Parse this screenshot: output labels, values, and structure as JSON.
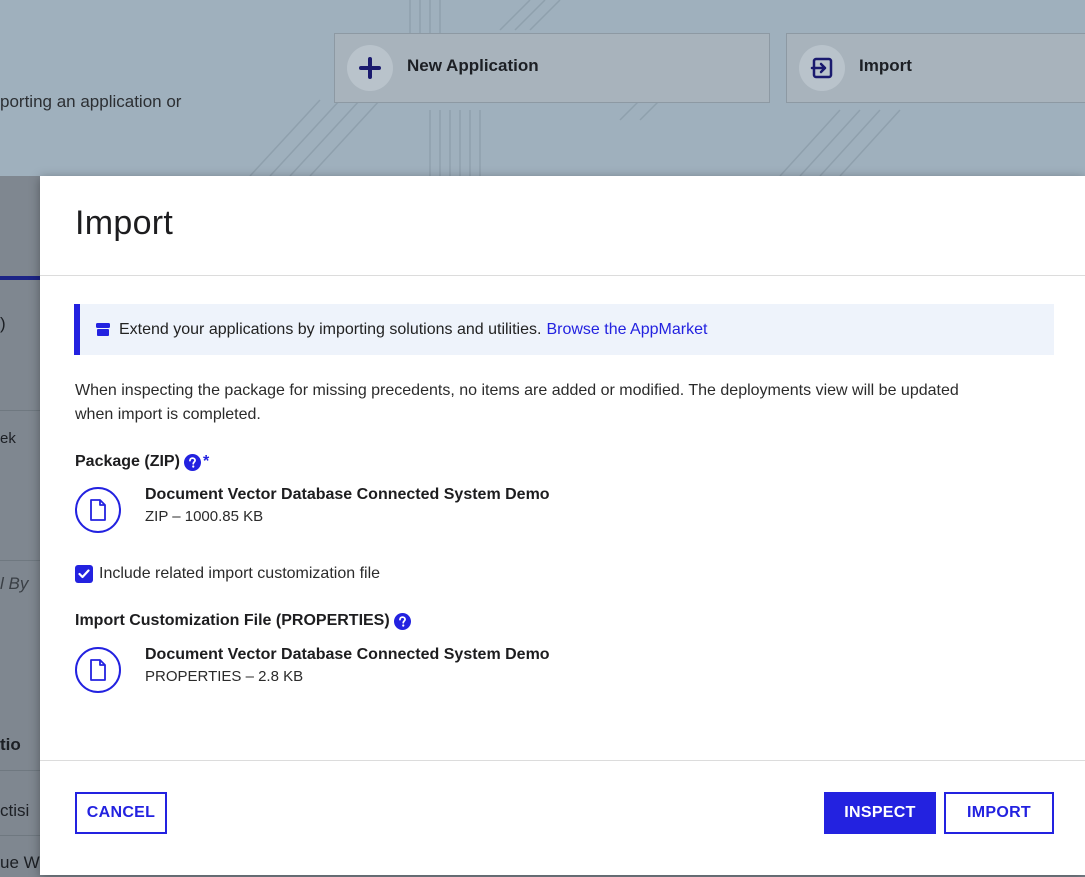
{
  "background": {
    "banner_text": "porting an application or",
    "tiles": {
      "new_application": {
        "label": "New Application",
        "icon": "plus-icon"
      },
      "import": {
        "label": "Import",
        "icon": "import-arrow-icon"
      }
    },
    "side_fragments": {
      "frag1": ")",
      "frag2": "ek",
      "frag3": "l By",
      "frag4": "tio",
      "frag5": "ctisi",
      "frag6": "ue W"
    }
  },
  "modal": {
    "title": "Import",
    "info": {
      "text": "Extend your applications by importing solutions and utilities.",
      "link": "Browse the AppMarket",
      "icon": "store-icon"
    },
    "description": "When inspecting the package for missing precedents, no items are added or modified. The deployments view will be updated when import is completed.",
    "package": {
      "label": "Package (ZIP)",
      "required_mark": "*",
      "file_name": "Document Vector Database Connected System Demo",
      "file_meta": "ZIP – 1000.85 KB"
    },
    "include_customization": {
      "label": "Include related import customization file",
      "checked": true
    },
    "customization": {
      "label": "Import Customization File (PROPERTIES)",
      "file_name": "Document Vector Database Connected System Demo",
      "file_meta": "PROPERTIES – 2.8 KB"
    },
    "buttons": {
      "cancel": "CANCEL",
      "inspect": "INSPECT",
      "import": "IMPORT"
    }
  },
  "colors": {
    "accent": "#2322e0",
    "overlay": "#7f8790",
    "banner_bg": "#eef3fb"
  }
}
